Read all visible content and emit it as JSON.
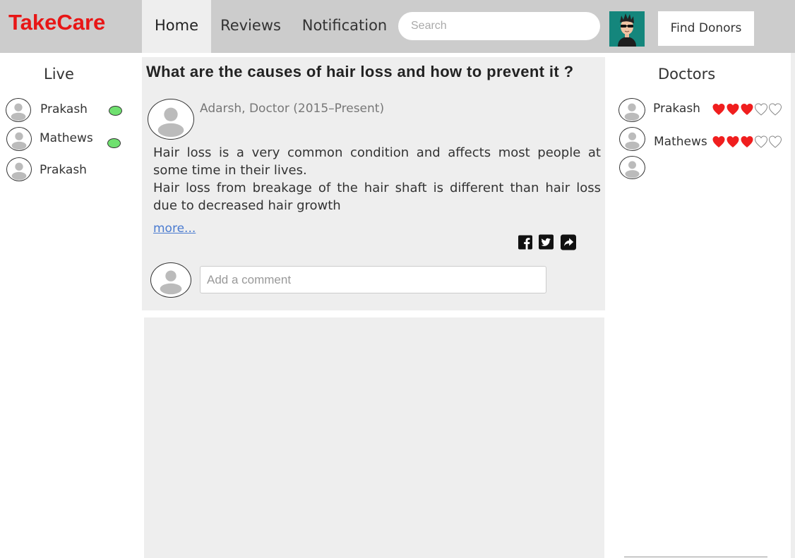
{
  "header": {
    "logo": "TakeCare",
    "nav": [
      {
        "label": "Home",
        "active": true
      },
      {
        "label": "Reviews",
        "active": false
      },
      {
        "label": "Notification",
        "active": false
      }
    ],
    "search_placeholder": "Search",
    "find_donors_label": "Find Donors",
    "profile_icon": "user-avatar-icon",
    "colors": {
      "logo": "#e81616",
      "bar": "#cccccc",
      "avatar_bg": "#14867c"
    }
  },
  "live": {
    "title": "Live",
    "items": [
      {
        "name": "Prakash",
        "online": true
      },
      {
        "name": "Mathews",
        "online": true
      },
      {
        "name": "Prakash",
        "online": false
      }
    ],
    "online_color": "#6fe06f"
  },
  "post": {
    "title": "What are the causes of hair loss and how to prevent it ?",
    "author": "Adarsh, Doctor (2015–Present)",
    "body": "Hair loss is a very common condition and affects most people at some time in their lives.\nHair loss from breakage of the hair shaft is different than hair loss due to decreased hair growth",
    "more_label": "more...",
    "share_icons": [
      "facebook-icon",
      "twitter-icon",
      "share-icon"
    ],
    "comment_placeholder": "Add a comment"
  },
  "doctors": {
    "title": "Doctors",
    "items": [
      {
        "name": "Prakash",
        "rating": 3,
        "max_rating": 5
      },
      {
        "name": "Mathews",
        "rating": 3,
        "max_rating": 5
      },
      {
        "name": "",
        "rating": null,
        "max_rating": 5
      }
    ],
    "heart_color": "#f01e1e"
  }
}
